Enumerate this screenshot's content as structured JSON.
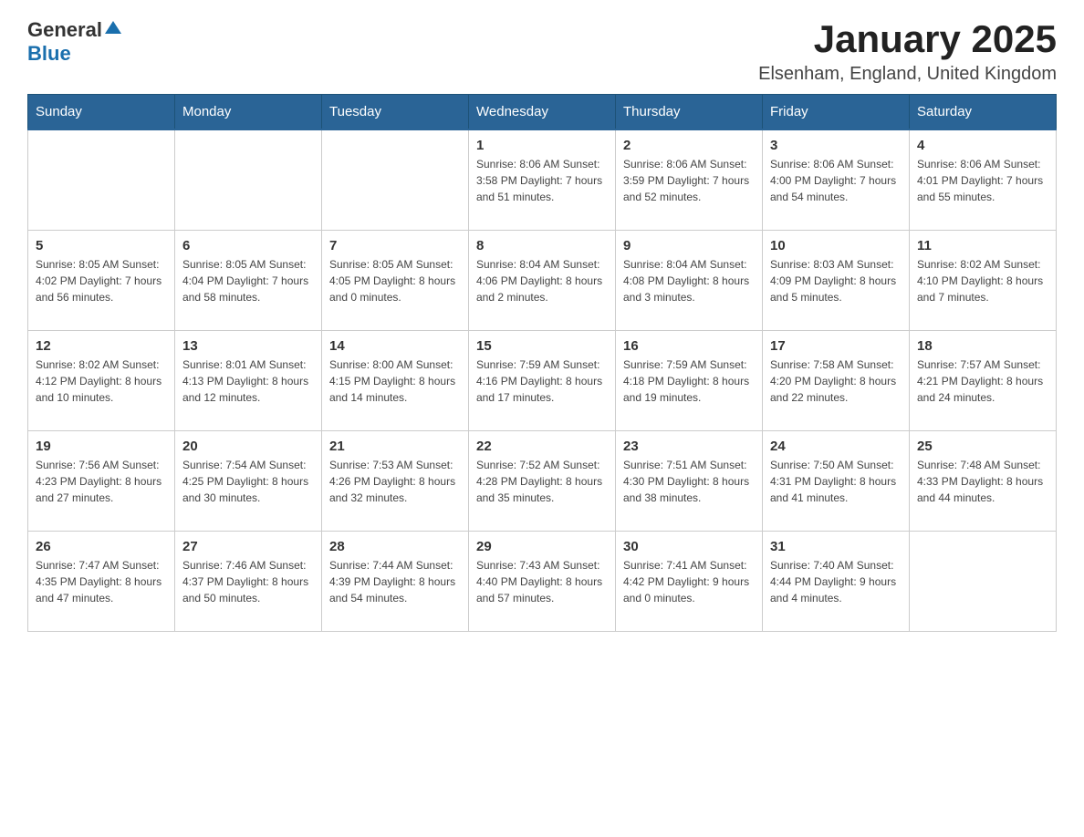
{
  "header": {
    "logo": {
      "general": "General",
      "blue": "Blue"
    },
    "title": "January 2025",
    "subtitle": "Elsenham, England, United Kingdom"
  },
  "calendar": {
    "headers": [
      "Sunday",
      "Monday",
      "Tuesday",
      "Wednesday",
      "Thursday",
      "Friday",
      "Saturday"
    ],
    "weeks": [
      [
        {
          "day": "",
          "info": ""
        },
        {
          "day": "",
          "info": ""
        },
        {
          "day": "",
          "info": ""
        },
        {
          "day": "1",
          "info": "Sunrise: 8:06 AM\nSunset: 3:58 PM\nDaylight: 7 hours\nand 51 minutes."
        },
        {
          "day": "2",
          "info": "Sunrise: 8:06 AM\nSunset: 3:59 PM\nDaylight: 7 hours\nand 52 minutes."
        },
        {
          "day": "3",
          "info": "Sunrise: 8:06 AM\nSunset: 4:00 PM\nDaylight: 7 hours\nand 54 minutes."
        },
        {
          "day": "4",
          "info": "Sunrise: 8:06 AM\nSunset: 4:01 PM\nDaylight: 7 hours\nand 55 minutes."
        }
      ],
      [
        {
          "day": "5",
          "info": "Sunrise: 8:05 AM\nSunset: 4:02 PM\nDaylight: 7 hours\nand 56 minutes."
        },
        {
          "day": "6",
          "info": "Sunrise: 8:05 AM\nSunset: 4:04 PM\nDaylight: 7 hours\nand 58 minutes."
        },
        {
          "day": "7",
          "info": "Sunrise: 8:05 AM\nSunset: 4:05 PM\nDaylight: 8 hours\nand 0 minutes."
        },
        {
          "day": "8",
          "info": "Sunrise: 8:04 AM\nSunset: 4:06 PM\nDaylight: 8 hours\nand 2 minutes."
        },
        {
          "day": "9",
          "info": "Sunrise: 8:04 AM\nSunset: 4:08 PM\nDaylight: 8 hours\nand 3 minutes."
        },
        {
          "day": "10",
          "info": "Sunrise: 8:03 AM\nSunset: 4:09 PM\nDaylight: 8 hours\nand 5 minutes."
        },
        {
          "day": "11",
          "info": "Sunrise: 8:02 AM\nSunset: 4:10 PM\nDaylight: 8 hours\nand 7 minutes."
        }
      ],
      [
        {
          "day": "12",
          "info": "Sunrise: 8:02 AM\nSunset: 4:12 PM\nDaylight: 8 hours\nand 10 minutes."
        },
        {
          "day": "13",
          "info": "Sunrise: 8:01 AM\nSunset: 4:13 PM\nDaylight: 8 hours\nand 12 minutes."
        },
        {
          "day": "14",
          "info": "Sunrise: 8:00 AM\nSunset: 4:15 PM\nDaylight: 8 hours\nand 14 minutes."
        },
        {
          "day": "15",
          "info": "Sunrise: 7:59 AM\nSunset: 4:16 PM\nDaylight: 8 hours\nand 17 minutes."
        },
        {
          "day": "16",
          "info": "Sunrise: 7:59 AM\nSunset: 4:18 PM\nDaylight: 8 hours\nand 19 minutes."
        },
        {
          "day": "17",
          "info": "Sunrise: 7:58 AM\nSunset: 4:20 PM\nDaylight: 8 hours\nand 22 minutes."
        },
        {
          "day": "18",
          "info": "Sunrise: 7:57 AM\nSunset: 4:21 PM\nDaylight: 8 hours\nand 24 minutes."
        }
      ],
      [
        {
          "day": "19",
          "info": "Sunrise: 7:56 AM\nSunset: 4:23 PM\nDaylight: 8 hours\nand 27 minutes."
        },
        {
          "day": "20",
          "info": "Sunrise: 7:54 AM\nSunset: 4:25 PM\nDaylight: 8 hours\nand 30 minutes."
        },
        {
          "day": "21",
          "info": "Sunrise: 7:53 AM\nSunset: 4:26 PM\nDaylight: 8 hours\nand 32 minutes."
        },
        {
          "day": "22",
          "info": "Sunrise: 7:52 AM\nSunset: 4:28 PM\nDaylight: 8 hours\nand 35 minutes."
        },
        {
          "day": "23",
          "info": "Sunrise: 7:51 AM\nSunset: 4:30 PM\nDaylight: 8 hours\nand 38 minutes."
        },
        {
          "day": "24",
          "info": "Sunrise: 7:50 AM\nSunset: 4:31 PM\nDaylight: 8 hours\nand 41 minutes."
        },
        {
          "day": "25",
          "info": "Sunrise: 7:48 AM\nSunset: 4:33 PM\nDaylight: 8 hours\nand 44 minutes."
        }
      ],
      [
        {
          "day": "26",
          "info": "Sunrise: 7:47 AM\nSunset: 4:35 PM\nDaylight: 8 hours\nand 47 minutes."
        },
        {
          "day": "27",
          "info": "Sunrise: 7:46 AM\nSunset: 4:37 PM\nDaylight: 8 hours\nand 50 minutes."
        },
        {
          "day": "28",
          "info": "Sunrise: 7:44 AM\nSunset: 4:39 PM\nDaylight: 8 hours\nand 54 minutes."
        },
        {
          "day": "29",
          "info": "Sunrise: 7:43 AM\nSunset: 4:40 PM\nDaylight: 8 hours\nand 57 minutes."
        },
        {
          "day": "30",
          "info": "Sunrise: 7:41 AM\nSunset: 4:42 PM\nDaylight: 9 hours\nand 0 minutes."
        },
        {
          "day": "31",
          "info": "Sunrise: 7:40 AM\nSunset: 4:44 PM\nDaylight: 9 hours\nand 4 minutes."
        },
        {
          "day": "",
          "info": ""
        }
      ]
    ]
  }
}
